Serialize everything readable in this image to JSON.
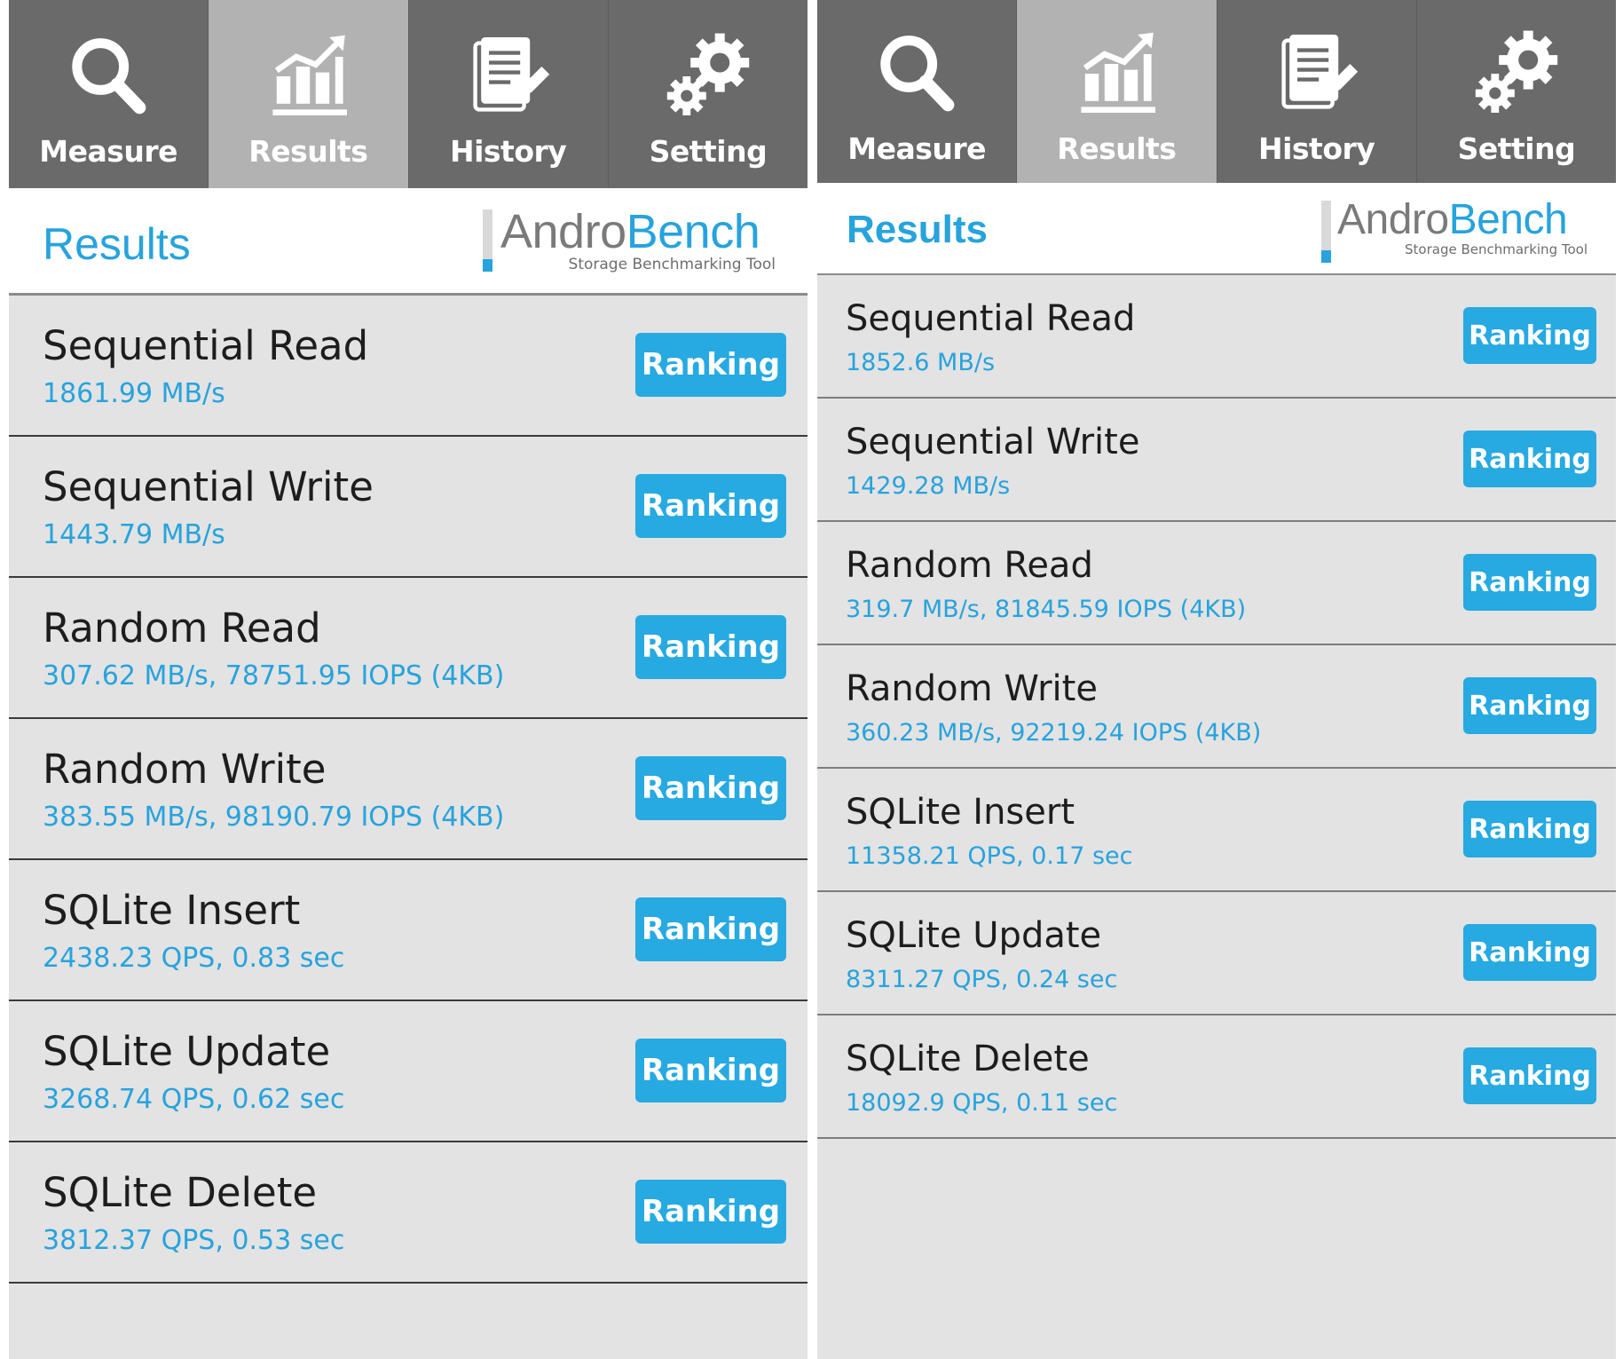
{
  "panels": [
    {
      "tabs": [
        {
          "label": "Measure",
          "icon": "magnifier-icon",
          "active": false
        },
        {
          "label": "Results",
          "icon": "chart-icon",
          "active": true
        },
        {
          "label": "History",
          "icon": "document-icon",
          "active": false
        },
        {
          "label": "Setting",
          "icon": "gears-icon",
          "active": false
        }
      ],
      "title": "Results",
      "logo": {
        "andro": "Andro",
        "bench": "Bench",
        "tagline": "Storage Benchmarking Tool"
      },
      "button_label": "Ranking",
      "results": [
        {
          "name": "Sequential Read",
          "value": "1861.99 MB/s"
        },
        {
          "name": "Sequential Write",
          "value": "1443.79 MB/s"
        },
        {
          "name": "Random Read",
          "value": "307.62 MB/s, 78751.95 IOPS (4KB)"
        },
        {
          "name": "Random Write",
          "value": "383.55 MB/s, 98190.79 IOPS (4KB)"
        },
        {
          "name": "SQLite Insert",
          "value": "2438.23 QPS, 0.83 sec"
        },
        {
          "name": "SQLite Update",
          "value": "3268.74 QPS, 0.62 sec"
        },
        {
          "name": "SQLite Delete",
          "value": "3812.37 QPS, 0.53 sec"
        }
      ]
    },
    {
      "tabs": [
        {
          "label": "Measure",
          "icon": "magnifier-icon",
          "active": false
        },
        {
          "label": "Results",
          "icon": "chart-icon",
          "active": true
        },
        {
          "label": "History",
          "icon": "document-icon",
          "active": false
        },
        {
          "label": "Setting",
          "icon": "gears-icon",
          "active": false
        }
      ],
      "title": "Results",
      "logo": {
        "andro": "Andro",
        "bench": "Bench",
        "tagline": "Storage Benchmarking Tool"
      },
      "button_label": "Ranking",
      "results": [
        {
          "name": "Sequential Read",
          "value": "1852.6 MB/s"
        },
        {
          "name": "Sequential Write",
          "value": "1429.28 MB/s"
        },
        {
          "name": "Random Read",
          "value": "319.7 MB/s, 81845.59 IOPS (4KB)"
        },
        {
          "name": "Random Write",
          "value": "360.23 MB/s, 92219.24 IOPS (4KB)"
        },
        {
          "name": "SQLite Insert",
          "value": "11358.21 QPS, 0.17 sec"
        },
        {
          "name": "SQLite Update",
          "value": "8311.27 QPS, 0.24 sec"
        },
        {
          "name": "SQLite Delete",
          "value": "18092.9 QPS, 0.11 sec"
        }
      ]
    }
  ],
  "colors": {
    "accent": "#27a9e1",
    "nav_bg": "#6a6a6a",
    "nav_active": "#b2b2b2",
    "list_bg": "#e3e3e3"
  }
}
